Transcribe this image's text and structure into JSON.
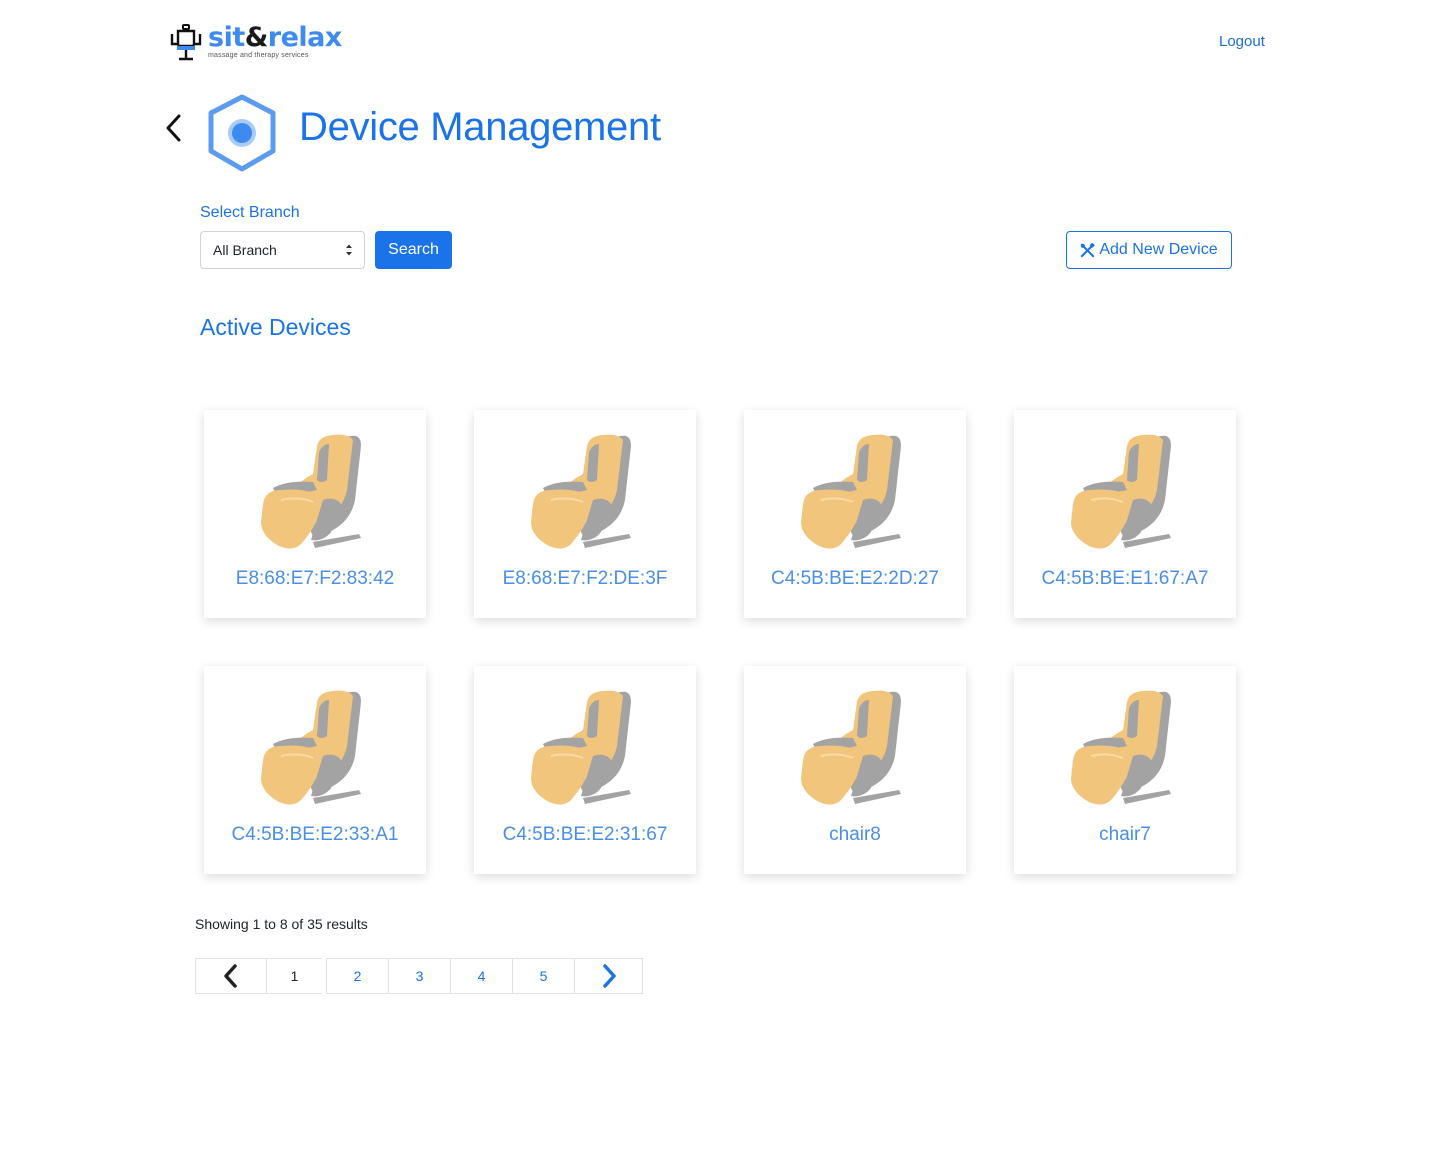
{
  "header": {
    "logo_sit": "sit",
    "logo_amp": "&",
    "logo_relax": "relax",
    "logo_tagline": "massage and therapy services",
    "logout_label": "Logout"
  },
  "page": {
    "title": "Device Management",
    "icon": "device-hexagon-icon"
  },
  "filters": {
    "branch_label": "Select Branch",
    "branch_selected": "All Branch",
    "search_label": "Search",
    "add_device_label": "Add New Device"
  },
  "section": {
    "active_devices_title": "Active Devices"
  },
  "devices": [
    {
      "name": "E8:68:E7:F2:83:42"
    },
    {
      "name": "E8:68:E7:F2:DE:3F"
    },
    {
      "name": "C4:5B:BE:E2:2D:27"
    },
    {
      "name": "C4:5B:BE:E1:67:A7"
    },
    {
      "name": "C4:5B:BE:E2:33:A1"
    },
    {
      "name": "C4:5B:BE:E2:31:67"
    },
    {
      "name": "chair8"
    },
    {
      "name": "chair7"
    }
  ],
  "pagination": {
    "summary": "Showing 1 to 8 of 35 results",
    "current": "1",
    "pages": [
      "2",
      "3",
      "4",
      "5"
    ]
  },
  "colors": {
    "accent": "#1a73e8",
    "chair_seat": "#f2c57c",
    "chair_frame": "#a3a3a3"
  }
}
